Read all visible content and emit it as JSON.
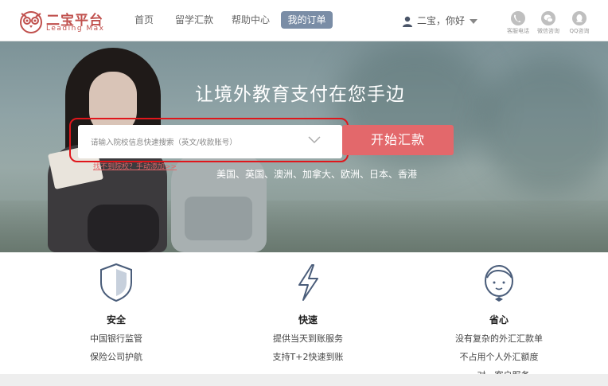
{
  "brand": {
    "title": "二宝平台",
    "subtitle": "Leading Max",
    "color": "#c0504d"
  },
  "nav": {
    "items": [
      "首页",
      "留学汇款",
      "帮助中心"
    ],
    "active": "我的订单"
  },
  "user": {
    "greeting": "二宝，你好"
  },
  "contacts": [
    {
      "label": "客服电话",
      "icon": "phone-icon"
    },
    {
      "label": "微信咨询",
      "icon": "wechat-icon"
    },
    {
      "label": "QQ咨询",
      "icon": "qq-icon"
    }
  ],
  "hero": {
    "title": "让境外教育支付在您手边",
    "search_placeholder": "请输入院校信息快速搜索（英文/收款账号）",
    "start_button": "开始汇款",
    "regions": "美国、英国、澳洲、加拿大、欧洲、日本、香港",
    "cant_find": "找不到院校？手动添加>>"
  },
  "features": [
    {
      "icon": "shield-icon",
      "title": "安全",
      "lines": [
        "中国银行监管",
        "保险公司护航"
      ]
    },
    {
      "icon": "lightning-icon",
      "title": "快速",
      "lines": [
        "提供当天到账服务",
        "支持T+2快速到账"
      ]
    },
    {
      "icon": "customer-service-icon",
      "title": "省心",
      "lines": [
        "没有复杂的外汇汇款单",
        "不占用个人外汇额度",
        "一对一客户服务"
      ]
    }
  ],
  "colors": {
    "accent": "#e3686b",
    "nav_active": "#7a8da6",
    "highlight": "#e0161b"
  }
}
